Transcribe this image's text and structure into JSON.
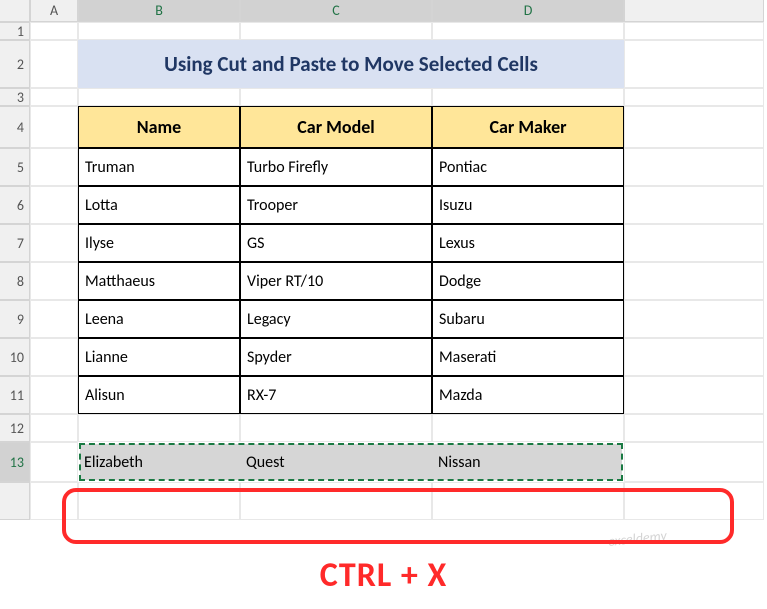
{
  "columns": [
    "A",
    "B",
    "C",
    "D"
  ],
  "rows": [
    "1",
    "2",
    "3",
    "4",
    "5",
    "6",
    "7",
    "8",
    "9",
    "10",
    "11",
    "12",
    "13"
  ],
  "title": "Using Cut and Paste to Move Selected Cells",
  "headers": {
    "name": "Name",
    "model": "Car Model",
    "maker": "Car Maker"
  },
  "data": [
    {
      "name": "Truman",
      "model": "Turbo Firefly",
      "maker": "Pontiac"
    },
    {
      "name": "Lotta",
      "model": "Trooper",
      "maker": "Isuzu"
    },
    {
      "name": "Ilyse",
      "model": "GS",
      "maker": "Lexus"
    },
    {
      "name": "Matthaeus",
      "model": "Viper RT/10",
      "maker": "Dodge"
    },
    {
      "name": "Leena",
      "model": "Legacy",
      "maker": "Subaru"
    },
    {
      "name": "Lianne",
      "model": "Spyder",
      "maker": "Maserati"
    },
    {
      "name": "Alisun",
      "model": "RX-7",
      "maker": "Mazda"
    }
  ],
  "cut_row": {
    "name": "Elizabeth",
    "model": "Quest",
    "maker": "Nissan"
  },
  "shortcut_label": "CTRL + X",
  "watermark": "exceldemy"
}
